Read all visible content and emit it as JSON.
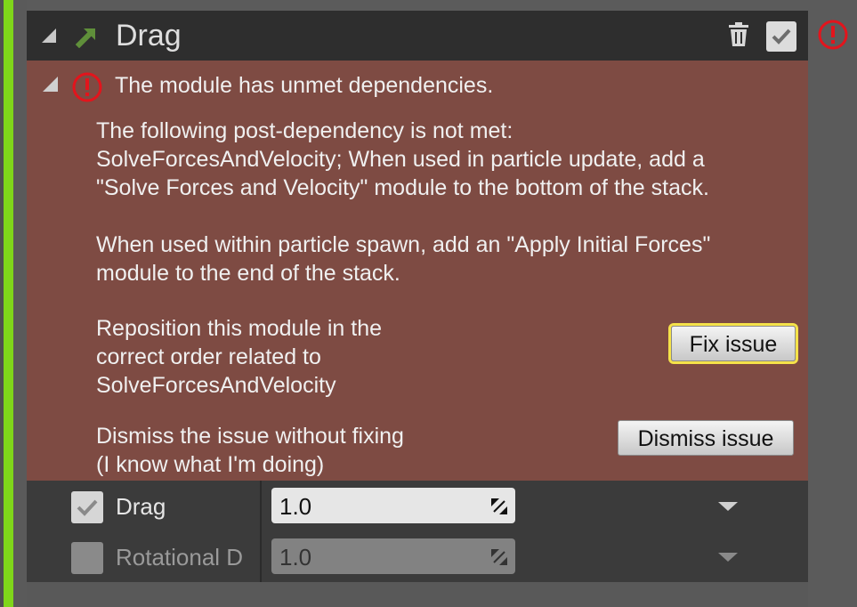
{
  "module": {
    "title": "Drag",
    "icon": "green-arrow-icon",
    "enabled": true
  },
  "issue": {
    "title": "The module has unmet dependencies.",
    "description": "The following post-dependency is not met:\nSolveForcesAndVelocity; When used in particle update, add a\n\"Solve Forces and Velocity\" module to the bottom of the stack.",
    "spawn_note": "When used within particle spawn, add an \"Apply Initial Forces\"\nmodule to the end of the stack.",
    "fix_description": "Reposition this module in the\ncorrect order related to\nSolveForcesAndVelocity",
    "fix_label": "Fix issue",
    "dismiss_description": "Dismiss the issue without fixing\n(I know what I'm doing)",
    "dismiss_label": "Dismiss issue"
  },
  "parameters": [
    {
      "label": "Drag",
      "value": "1.0",
      "checked": true
    },
    {
      "label": "Rotational D",
      "value": "1.0",
      "checked": false
    }
  ],
  "colors": {
    "accent": "#7fd61a",
    "issue_background": "#7e4b43",
    "error_red": "#e3141c",
    "highlight": "#f5e24a"
  }
}
